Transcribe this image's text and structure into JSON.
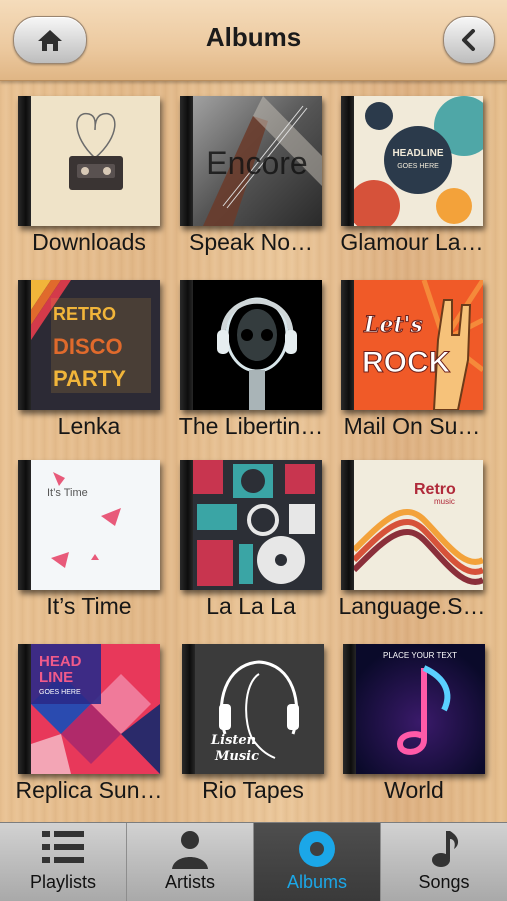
{
  "header": {
    "title": "Albums",
    "home_icon": "home-icon",
    "back_icon": "chevron-left-icon"
  },
  "albums": [
    {
      "label": "Downloads"
    },
    {
      "label": "Speak No…",
      "cover_text": "Encore"
    },
    {
      "label": "Glamour La…",
      "cover_text": [
        "HEADLINE",
        "GOES HERE"
      ]
    },
    {
      "label": "Lenka",
      "cover_text": [
        "RETRO",
        "DISCO",
        "PARTY"
      ]
    },
    {
      "label": "The Libertin…"
    },
    {
      "label": "Mail On Su…",
      "cover_text": [
        "Let's",
        "ROCK"
      ]
    },
    {
      "label": "It’s Time",
      "cover_text": "It’s Time"
    },
    {
      "label": "La La La"
    },
    {
      "label": "Language.S…",
      "cover_text": [
        "Retro",
        "music"
      ]
    },
    {
      "label": "Replica Sun…",
      "cover_text": [
        "HEAD",
        "LINE",
        "GOES HERE"
      ]
    },
    {
      "label": "Rio Tapes",
      "cover_text": [
        "Listen",
        "Music"
      ]
    },
    {
      "label": "World",
      "cover_text": "PLACE YOUR TEXT"
    }
  ],
  "tabs": [
    {
      "label": "Playlists",
      "icon": "list-icon",
      "active": false
    },
    {
      "label": "Artists",
      "icon": "person-icon",
      "active": false
    },
    {
      "label": "Albums",
      "icon": "disc-icon",
      "active": true
    },
    {
      "label": "Songs",
      "icon": "music-note-icon",
      "active": false
    }
  ],
  "colors": {
    "accent": "#1ba7e8",
    "wood": "#e6bf90"
  }
}
